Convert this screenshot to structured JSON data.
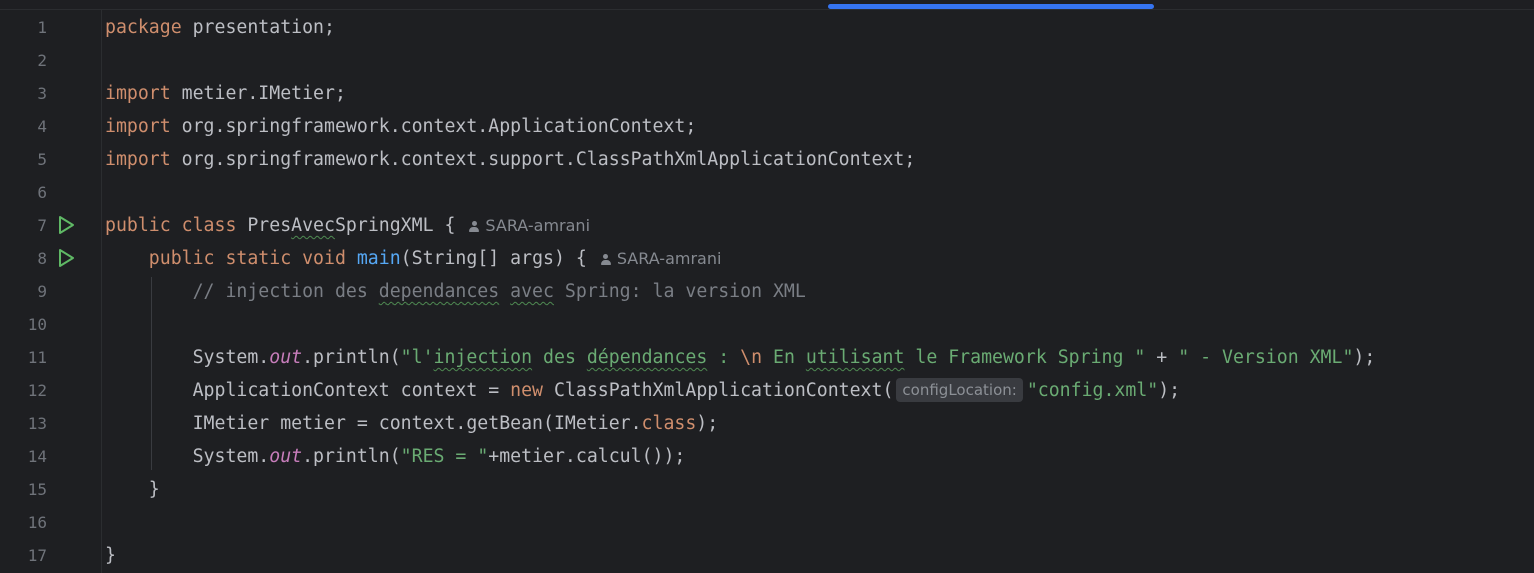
{
  "editor": {
    "line_numbers": [
      "1",
      "2",
      "3",
      "4",
      "5",
      "6",
      "7",
      "8",
      "9",
      "10",
      "11",
      "12",
      "13",
      "14",
      "15",
      "16",
      "17"
    ],
    "tokens": {
      "package_kw": "package",
      "package_name": " presentation;",
      "import_kw": "import",
      "import1": " metier.IMetier;",
      "import2": " org.springframework.context.ApplicationContext;",
      "import3": " org.springframework.context.support.ClassPathXmlApplicationContext;",
      "l7_kw": "public class",
      "l7_pre": " Pres",
      "l7_typo": "Avec",
      "l7_post": "SpringXML {",
      "l8_kw": "    public static void",
      "l8_fn": "main",
      "l8_rest": "(String[] args) {",
      "l9_a": "        // injection des ",
      "l9_b": "dependances",
      "l9_c": " ",
      "l9_d": "avec",
      "l9_e": " Spring: la version XML",
      "l11_a": "        System.",
      "l11_out": "out",
      "l11_b": ".println(",
      "l11_s1": "\"l'",
      "l11_s1typo": "injection",
      "l11_s2": " des ",
      "l11_s2typo": "dépendances",
      "l11_s3": " : ",
      "l11_esc": "\\n",
      "l11_s4": " En ",
      "l11_s4typo": "utilisant",
      "l11_s5": " le Framework Spring \"",
      "l11_plus": " + ",
      "l11_s6": "\" - Version XML\"",
      "l11_end": ");",
      "l12_a": "        ApplicationContext context = ",
      "l12_new": "new",
      "l12_b": " ClassPathXmlApplicationContext(",
      "l12_hint": "configLocation:",
      "l12_str": "\"config.xml\"",
      "l12_end": ");",
      "l13_a": "        IMetier metier = context.getBean(IMetier.",
      "l13_cls": "class",
      "l13_end": ");",
      "l14_a": "        System.",
      "l14_out": "out",
      "l14_b": ".println(",
      "l14_str": "\"RES = \"",
      "l14_end": "+metier.calcul());",
      "l15": "    }",
      "l17": "}"
    },
    "author_hint": "SARA-amrani",
    "run_icon": "run-gutter-icon"
  }
}
